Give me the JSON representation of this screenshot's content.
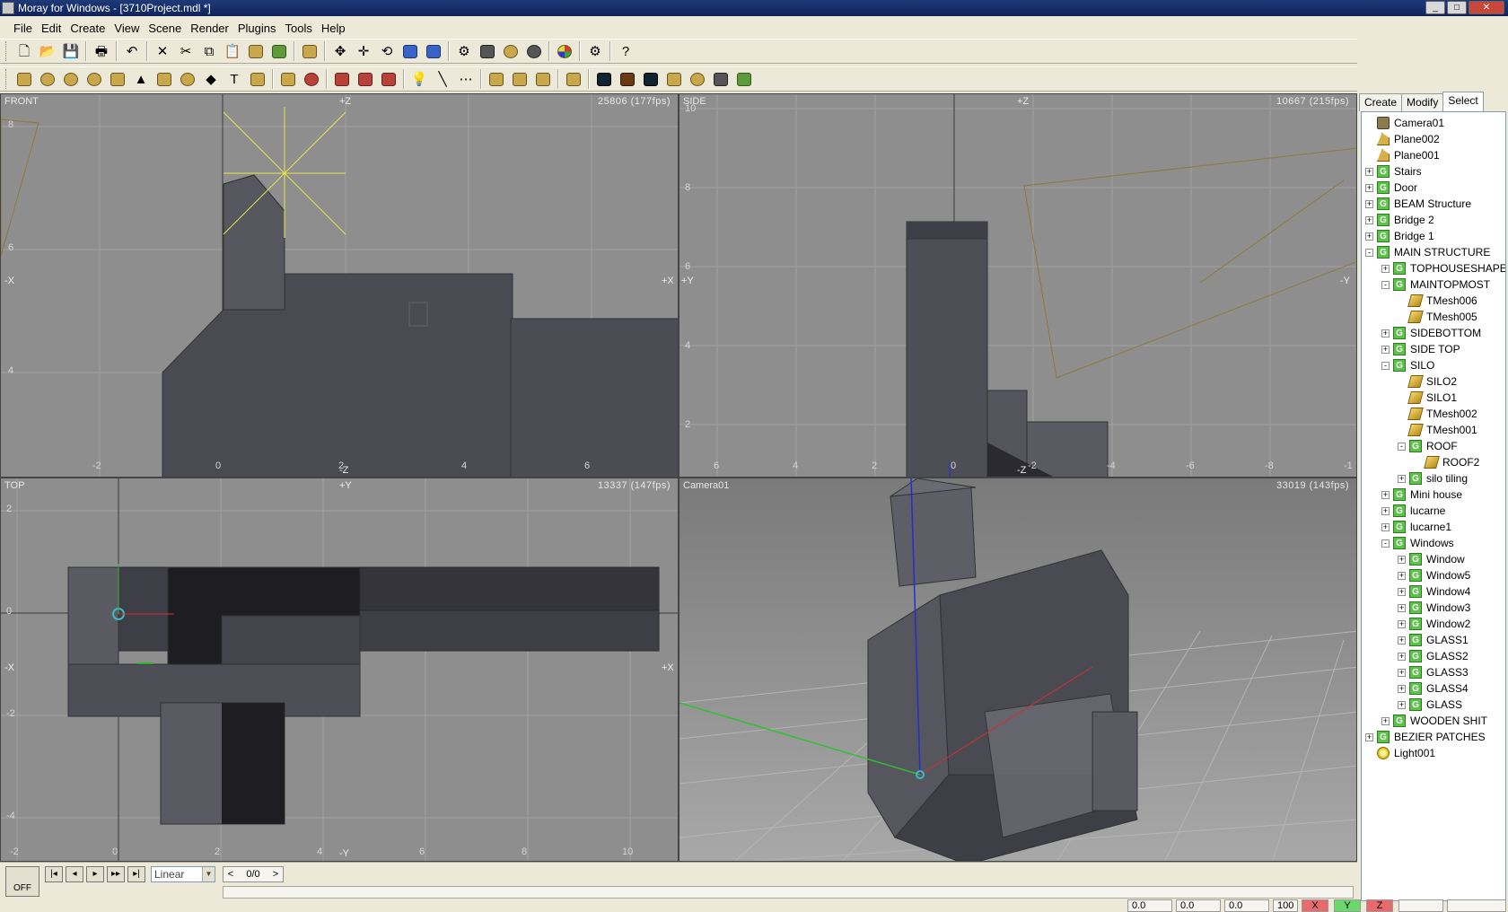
{
  "window": {
    "title": "Moray for Windows - [3710Project.mdl *]",
    "controls": [
      "_",
      "□",
      "✕"
    ]
  },
  "menu": [
    "File",
    "Edit",
    "Create",
    "View",
    "Scene",
    "Render",
    "Plugins",
    "Tools",
    "Help"
  ],
  "viewports": {
    "front": {
      "label": "FRONT",
      "stats": "25806   (177fps)",
      "axes": {
        "top": "+Z",
        "bottom": "-Z",
        "left": "-X",
        "right": "+X"
      },
      "ticks_x": [
        "-2",
        "0",
        "2",
        "4",
        "6"
      ],
      "ticks_y": [
        "8",
        "6",
        "4"
      ]
    },
    "side": {
      "label": "SIDE",
      "stats": "10667   (215fps)",
      "axes": {
        "top": "+Z",
        "bottom": "-Z",
        "left": "+Y",
        "right": "-Y"
      },
      "ticks_x": [
        "6",
        "4",
        "2",
        "0",
        "-2",
        "-4",
        "-6",
        "-8",
        "-1"
      ],
      "ticks_y": [
        "10",
        "8",
        "6",
        "4",
        "2"
      ]
    },
    "top": {
      "label": "TOP",
      "stats": "13337   (147fps)",
      "axes": {
        "top": "+Y",
        "bottom": "-Y",
        "left": "-X",
        "right": "+X"
      },
      "ticks_x": [
        "-2",
        "0",
        "2",
        "4",
        "6",
        "8",
        "10"
      ],
      "ticks_y": [
        "2",
        "0",
        "-2",
        "-4"
      ]
    },
    "camera": {
      "label": "Camera01",
      "stats": "33019   (143fps)"
    }
  },
  "panel": {
    "tabs": [
      "Create",
      "Modify",
      "Select"
    ],
    "active_tab": "Select",
    "tree": [
      {
        "label": "Camera01",
        "depth": 0,
        "icon": "camera",
        "exp": ""
      },
      {
        "label": "Plane002",
        "depth": 0,
        "icon": "plane",
        "exp": ""
      },
      {
        "label": "Plane001",
        "depth": 0,
        "icon": "plane",
        "exp": ""
      },
      {
        "label": "Stairs",
        "depth": 0,
        "icon": "group",
        "exp": "+"
      },
      {
        "label": "Door",
        "depth": 0,
        "icon": "group",
        "exp": "+"
      },
      {
        "label": "BEAM Structure",
        "depth": 0,
        "icon": "group",
        "exp": "+"
      },
      {
        "label": "Bridge 2",
        "depth": 0,
        "icon": "group",
        "exp": "+"
      },
      {
        "label": "Bridge 1",
        "depth": 0,
        "icon": "group",
        "exp": "+"
      },
      {
        "label": "MAIN STRUCTURE",
        "depth": 0,
        "icon": "group",
        "exp": "-"
      },
      {
        "label": "TOPHOUSESHAPE",
        "depth": 1,
        "icon": "group",
        "exp": "+"
      },
      {
        "label": "MAINTOPMOST",
        "depth": 1,
        "icon": "group",
        "exp": "-"
      },
      {
        "label": "TMesh006",
        "depth": 2,
        "icon": "mesh",
        "exp": ""
      },
      {
        "label": "TMesh005",
        "depth": 2,
        "icon": "mesh",
        "exp": ""
      },
      {
        "label": "SIDEBOTTOM",
        "depth": 1,
        "icon": "group",
        "exp": "+"
      },
      {
        "label": "SIDE TOP",
        "depth": 1,
        "icon": "group",
        "exp": "+"
      },
      {
        "label": "SILO",
        "depth": 1,
        "icon": "group",
        "exp": "-"
      },
      {
        "label": "SILO2",
        "depth": 2,
        "icon": "mesh",
        "exp": ""
      },
      {
        "label": "SILO1",
        "depth": 2,
        "icon": "mesh",
        "exp": ""
      },
      {
        "label": "TMesh002",
        "depth": 2,
        "icon": "mesh",
        "exp": ""
      },
      {
        "label": "TMesh001",
        "depth": 2,
        "icon": "mesh",
        "exp": ""
      },
      {
        "label": "ROOF",
        "depth": 2,
        "icon": "group",
        "exp": "-"
      },
      {
        "label": "ROOF2",
        "depth": 3,
        "icon": "mesh",
        "exp": ""
      },
      {
        "label": "silo tiling",
        "depth": 2,
        "icon": "group",
        "exp": "+"
      },
      {
        "label": "Mini house",
        "depth": 1,
        "icon": "group",
        "exp": "+"
      },
      {
        "label": "lucarne",
        "depth": 1,
        "icon": "group",
        "exp": "+"
      },
      {
        "label": "lucarne1",
        "depth": 1,
        "icon": "group",
        "exp": "+"
      },
      {
        "label": "Windows",
        "depth": 1,
        "icon": "group",
        "exp": "-"
      },
      {
        "label": "Window",
        "depth": 2,
        "icon": "group",
        "exp": "+"
      },
      {
        "label": "Window5",
        "depth": 2,
        "icon": "group",
        "exp": "+"
      },
      {
        "label": "Window4",
        "depth": 2,
        "icon": "group",
        "exp": "+"
      },
      {
        "label": "Window3",
        "depth": 2,
        "icon": "group",
        "exp": "+"
      },
      {
        "label": "Window2",
        "depth": 2,
        "icon": "group",
        "exp": "+"
      },
      {
        "label": "GLASS1",
        "depth": 2,
        "icon": "group",
        "exp": "+"
      },
      {
        "label": "GLASS2",
        "depth": 2,
        "icon": "group",
        "exp": "+"
      },
      {
        "label": "GLASS3",
        "depth": 2,
        "icon": "group",
        "exp": "+"
      },
      {
        "label": "GLASS4",
        "depth": 2,
        "icon": "group",
        "exp": "+"
      },
      {
        "label": "GLASS",
        "depth": 2,
        "icon": "group",
        "exp": "+"
      },
      {
        "label": "WOODEN SHIT",
        "depth": 1,
        "icon": "group",
        "exp": "+"
      },
      {
        "label": "BEZIER PATCHES",
        "depth": 0,
        "icon": "group",
        "exp": "+"
      },
      {
        "label": "Light001",
        "depth": 0,
        "icon": "light",
        "exp": ""
      }
    ]
  },
  "timeline": {
    "off_label": "OFF",
    "interpolation": "Linear",
    "frames": "0/0",
    "prev": "<",
    "next": ">"
  },
  "status": {
    "x": "0.0",
    "y": "0.0",
    "z": "0.0",
    "zoom": "100",
    "axis_x": "X",
    "axis_y": "Y",
    "axis_z": "Z"
  },
  "colors": {
    "viewport_bg": "#8c8c8c",
    "grid": "#a0a0a0",
    "object": "#4a4a52",
    "light": "#e6e650",
    "camera_wire": "#8a7a3a"
  }
}
